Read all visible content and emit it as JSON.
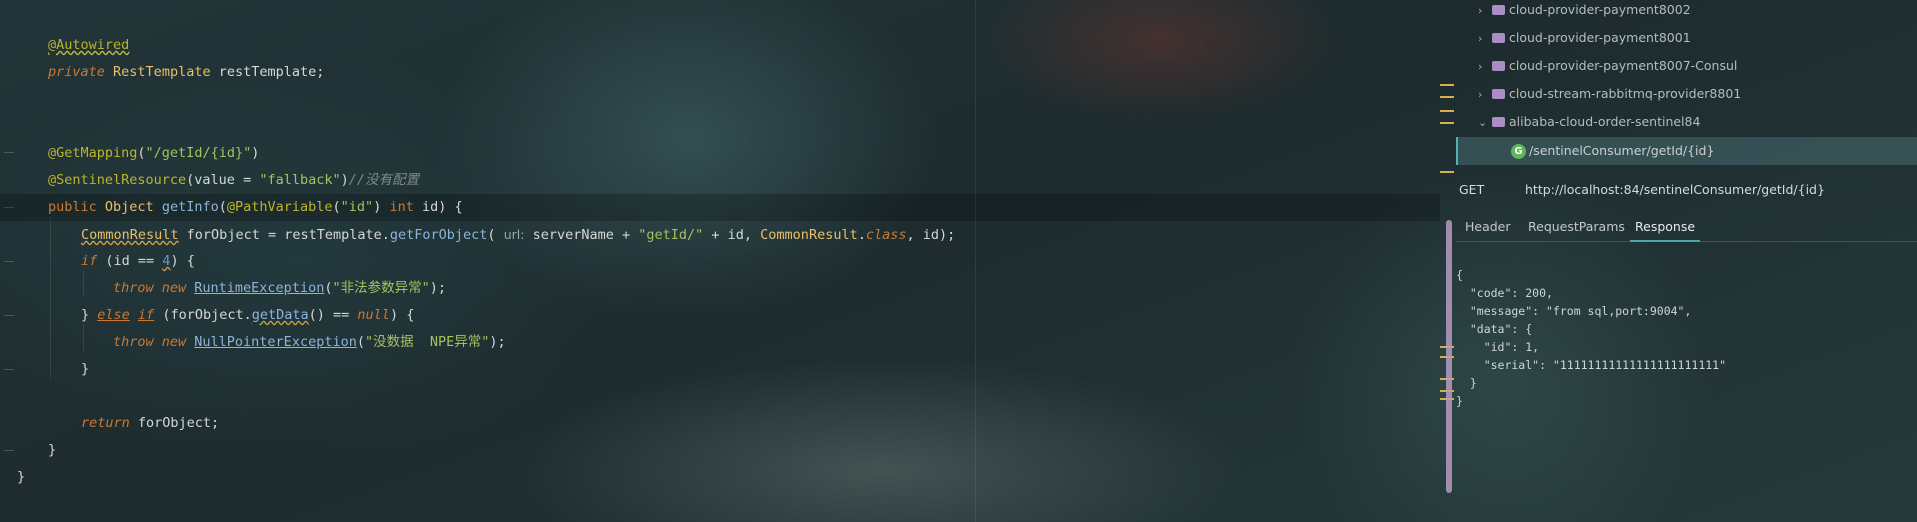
{
  "editor": {
    "lines": {
      "l1": {
        "ann": "@Autowired"
      },
      "l2": {
        "mod": "private",
        "type": "RestTemplate",
        "rest": " restTemplate;"
      },
      "l3": {
        "ann": "@GetMapping",
        "open": "(",
        "str": "\"/getId/{id}\"",
        "close": ")"
      },
      "l4": {
        "ann": "@SentinelResource",
        "open": "(value = ",
        "str": "\"fallback\"",
        "close": ")",
        "comment": "//没有配置"
      },
      "l5": {
        "kw": "public",
        "type": " Object ",
        "fn": "getInfo",
        "p1": "(",
        "ann": "@PathVariable",
        "p2": "(",
        "str": "\"id\"",
        "p3": ") ",
        "kw2": "int",
        "p4": " id) {"
      },
      "l6": {
        "type": "CommonResult",
        "a": " forObject = restTemplate.",
        "fn": "getForObject",
        "b": "( ",
        "hint": "url:",
        "c": " serverName + ",
        "str": "\"getId/\"",
        "d": " + id, ",
        "type2": "CommonResult",
        "e": ".",
        "kw": "class",
        "f": ", id);"
      },
      "l7": {
        "kw": "if",
        "a": " (id == ",
        "num": "4",
        "b": ") {"
      },
      "l8": {
        "kw1": "throw",
        "kw2": " new ",
        "cls": "RuntimeException",
        "a": "(",
        "str": "\"非法参数异常\"",
        "b": ");"
      },
      "l9": {
        "a": "} ",
        "kw1": "else",
        "sp": " ",
        "kw2": "if",
        "b": " (forObject.",
        "fn": "getData",
        "c": "() == ",
        "kw3": "null",
        "d": ") {"
      },
      "l10": {
        "kw1": "throw",
        "kw2": " new ",
        "cls": "NullPointerException",
        "a": "(",
        "str": "\"没数据  NPE异常\"",
        "b": ");"
      },
      "l11": {
        "text": "}"
      },
      "l12": {
        "kw": "return",
        "a": " forObject;"
      },
      "l13": {
        "text": "}"
      },
      "l14": {
        "text": "}"
      }
    }
  },
  "tree": {
    "items": [
      {
        "label": "cloud-provider-payment8002",
        "chevron": "›"
      },
      {
        "label": "cloud-provider-payment8001",
        "chevron": "›"
      },
      {
        "label": "cloud-provider-payment8007-Consul",
        "chevron": "›"
      },
      {
        "label": "cloud-stream-rabbitmq-provider8801",
        "chevron": "›"
      },
      {
        "label": "alibaba-cloud-order-sentinel84",
        "chevron": "⌄"
      }
    ],
    "selected": {
      "icon_letter": "G",
      "label": "/sentinelConsumer/getId/{id}"
    }
  },
  "request": {
    "method": "GET",
    "url": "http://localhost:84/sentinelConsumer/getId/{id}"
  },
  "tabs": {
    "header": "Header",
    "params": "RequestParams",
    "response": "Response"
  },
  "response": {
    "lines": {
      "j1": "{",
      "j2": "  \"code\": 200,",
      "j3": "  \"message\": \"from sql,port:9004\",",
      "j4": "  \"data\": {",
      "j5": "    \"id\": 1,",
      "j6": "    \"serial\": \"11111111111111111111111\"",
      "j7": "  }",
      "j8": "}"
    }
  },
  "colors": {
    "accent": "#4aa6b0",
    "folder": "#a98dc4",
    "scrollbar": "#b79bbf",
    "marker": "#d8b04a"
  }
}
